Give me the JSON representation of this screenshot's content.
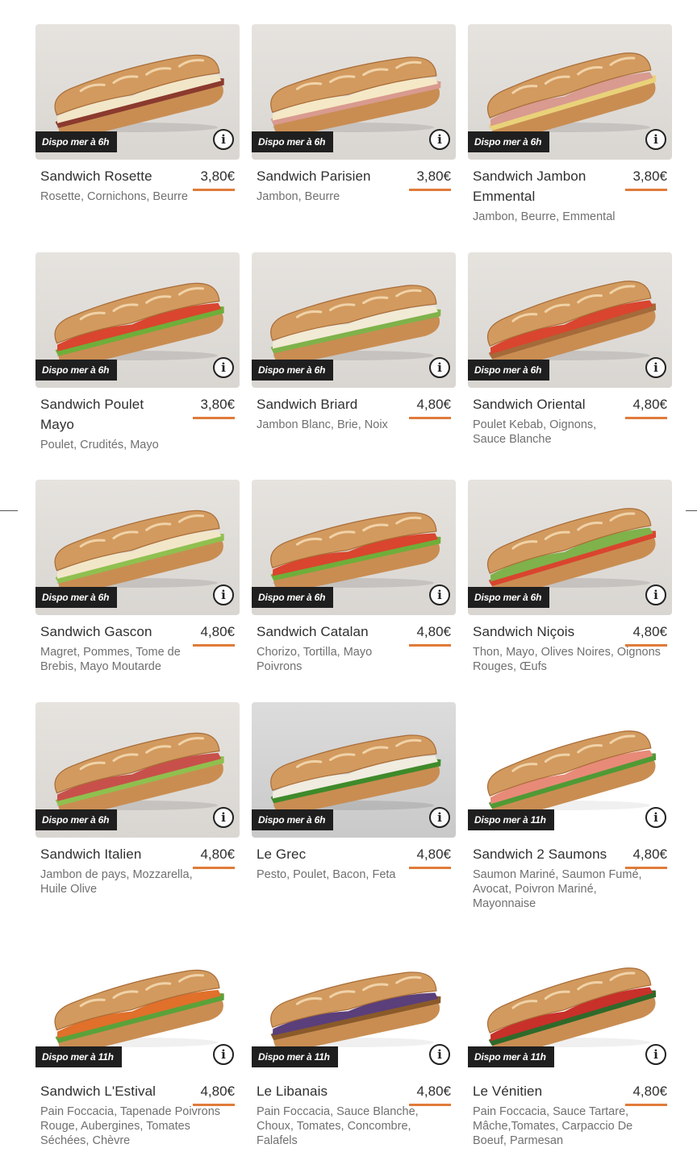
{
  "accent_color": "#e07b39",
  "items": [
    {
      "name": "Sandwich Rosette",
      "price": "3,80€",
      "desc": "Rosette, Cornichons, Beurre",
      "dispo": "Dispo mer à 6h",
      "bg": "beige",
      "fill": [
        "#8b3a2e",
        "#f2e6c8"
      ],
      "icon": "info-icon"
    },
    {
      "name": "Sandwich Parisien",
      "price": "3,80€",
      "desc": "Jambon, Beurre",
      "dispo": "Dispo mer à 6h",
      "bg": "beige",
      "fill": [
        "#d99a8f",
        "#f5e8c6"
      ],
      "icon": "info-icon"
    },
    {
      "name": "Sandwich Jambon Emmental",
      "price": "3,80€",
      "desc": "Jambon, Beurre, Emmental",
      "dispo": "Dispo mer à 6h",
      "bg": "beige",
      "fill": [
        "#e9d27a",
        "#d99a8f"
      ],
      "icon": "info-icon"
    },
    {
      "name": "Sandwich Poulet Mayo",
      "price": "3,80€",
      "desc": "Poulet, Crudités, Mayo",
      "dispo": "Dispo mer à 6h",
      "bg": "beige",
      "fill": [
        "#6fae3a",
        "#d9452e"
      ],
      "icon": "info-icon"
    },
    {
      "name": "Sandwich Briard",
      "price": "4,80€",
      "desc": "Jambon Blanc, Brie, Noix",
      "dispo": "Dispo mer à 6h",
      "bg": "beige",
      "fill": [
        "#7fb24a",
        "#f1ead5"
      ],
      "icon": "info-icon"
    },
    {
      "name": "Sandwich Oriental",
      "price": "4,80€",
      "desc": "Poulet Kebab, Oignons, Sauce Blanche",
      "dispo": "Dispo mer à 6h",
      "bg": "beige",
      "fill": [
        "#a56a3a",
        "#d9452e"
      ],
      "icon": "info-icon"
    },
    {
      "name": "Sandwich Gascon",
      "price": "4,80€",
      "desc": "Magret, Pommes, Tome de Brebis, Mayo Moutarde",
      "dispo": "Dispo mer à 6h",
      "bg": "beige",
      "fill": [
        "#8fc04f",
        "#f2e6c8"
      ],
      "icon": "info-icon"
    },
    {
      "name": "Sandwich Catalan",
      "price": "4,80€",
      "desc": "Chorizo, Tortilla, Mayo Poivrons",
      "dispo": "Dispo mer à 6h",
      "bg": "beige",
      "fill": [
        "#6fae3a",
        "#d9452e"
      ],
      "icon": "info-icon"
    },
    {
      "name": "Sandwich Niçois",
      "price": "4,80€",
      "desc": "Thon, Mayo, Olives Noires, Oignons Rouges, Œufs",
      "dispo": "Dispo mer à 6h",
      "bg": "beige",
      "fill": [
        "#d9452e",
        "#7fb24a"
      ],
      "icon": "info-icon"
    },
    {
      "name": "Sandwich Italien",
      "price": "4,80€",
      "desc": "Jambon de pays, Mozzarella, Huile Olive",
      "dispo": "Dispo mer à 6h",
      "bg": "beige",
      "fill": [
        "#8fc04f",
        "#c8504a"
      ],
      "icon": "info-icon"
    },
    {
      "name": "Le Grec",
      "price": "4,80€",
      "desc": "Pesto, Poulet, Bacon, Feta",
      "dispo": "Dispo mer à 6h",
      "bg": "grey",
      "fill": [
        "#3f8a2a",
        "#f0ece0"
      ],
      "icon": "info-icon"
    },
    {
      "name": "Sandwich 2 Saumons",
      "price": "4,80€",
      "desc": "Saumon Mariné, Saumon Fumé, Avocat, Poivron Mariné, Mayonnaise",
      "dispo": "Dispo mer à 11h",
      "bg": "white",
      "fill": [
        "#4f9a35",
        "#e88a78"
      ],
      "icon": "info-icon"
    },
    {
      "name": "Sandwich L'Estival",
      "price": "4,80€",
      "desc": "Pain Foccacia, Tapenade Poivrons Rouge, Aubergines, Tomates Séchées, Chèvre",
      "dispo": "Dispo mer à 11h",
      "bg": "white",
      "fill": [
        "#5aa23a",
        "#e0702a"
      ],
      "icon": "info-icon"
    },
    {
      "name": "Le Libanais",
      "price": "4,80€",
      "desc": "Pain Foccacia, Sauce Blanche, Choux, Tomates, Concombre, Falafels",
      "dispo": "Dispo mer à 11h",
      "bg": "white",
      "fill": [
        "#8a5a2a",
        "#5a3f7a"
      ],
      "icon": "info-icon"
    },
    {
      "name": "Le Vénitien",
      "price": "4,80€",
      "desc": "Pain Foccacia, Sauce Tartare, Mâche,Tomates, Carpaccio De Boeuf, Parmesan",
      "dispo": "Dispo mer à 11h",
      "bg": "white",
      "fill": [
        "#2f6a2a",
        "#c8302a"
      ],
      "icon": "info-icon"
    }
  ]
}
